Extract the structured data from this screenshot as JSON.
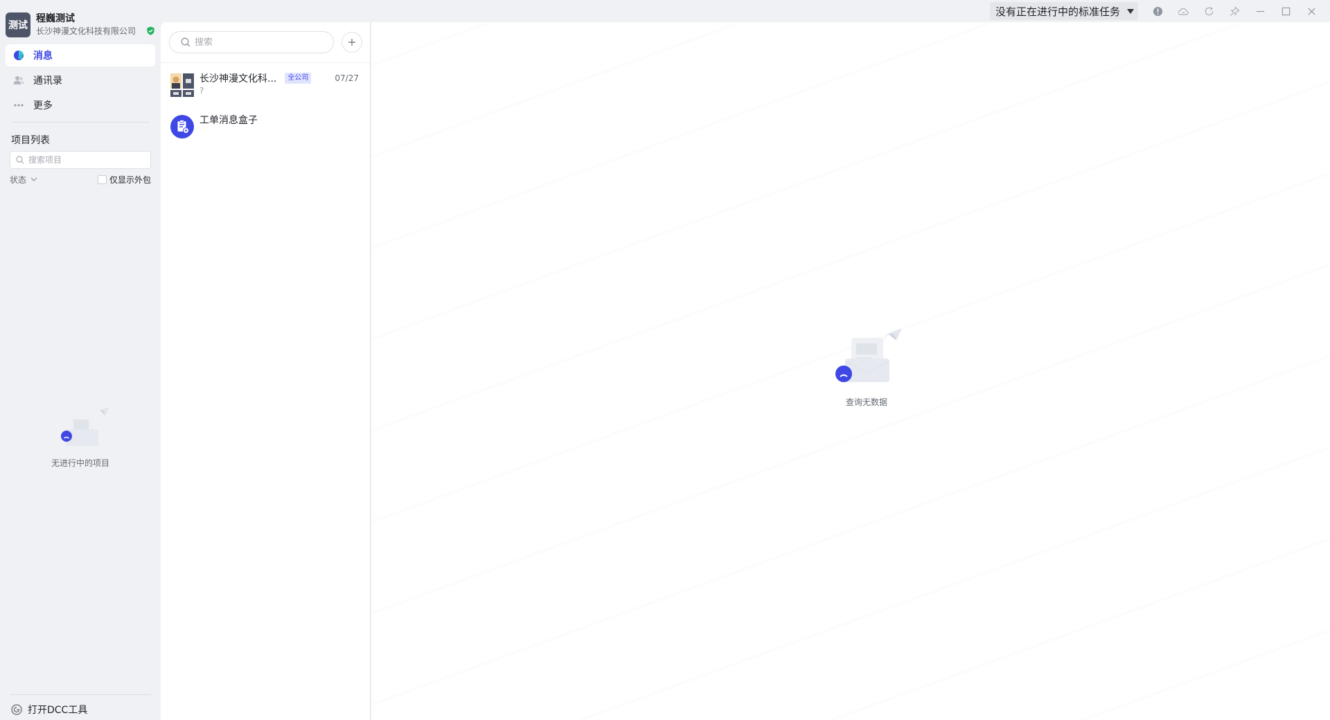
{
  "org": {
    "avatar_text": "测试",
    "name": "程巍测试",
    "company": "长沙神漫文化科技有限公司"
  },
  "nav": {
    "items": [
      {
        "label": "消息",
        "icon": "message-icon",
        "active": true
      },
      {
        "label": "通讯录",
        "icon": "contacts-icon",
        "active": false
      },
      {
        "label": "更多",
        "icon": "more-icon",
        "active": false
      }
    ]
  },
  "projects": {
    "title": "项目列表",
    "search_placeholder": "搜索项目",
    "status_label": "状态",
    "outsource_label": "仅显示外包",
    "empty_text": "无进行中的项目"
  },
  "footer": {
    "dcc_label": "打开DCC工具"
  },
  "titlebar": {
    "task_status": "没有正在进行中的标准任务"
  },
  "conversations": {
    "search_placeholder": "搜索",
    "items": [
      {
        "name": "长沙神漫文化科...",
        "tag": "全公司",
        "time": "07/27",
        "preview": "?"
      },
      {
        "name": "工单消息盒子",
        "tag": "",
        "time": "",
        "preview": ""
      }
    ]
  },
  "main": {
    "empty_text": "查询无数据"
  },
  "colors": {
    "accent": "#3f48e5",
    "verified": "#22b35e",
    "sidebar_bg": "#f0f1f4"
  }
}
